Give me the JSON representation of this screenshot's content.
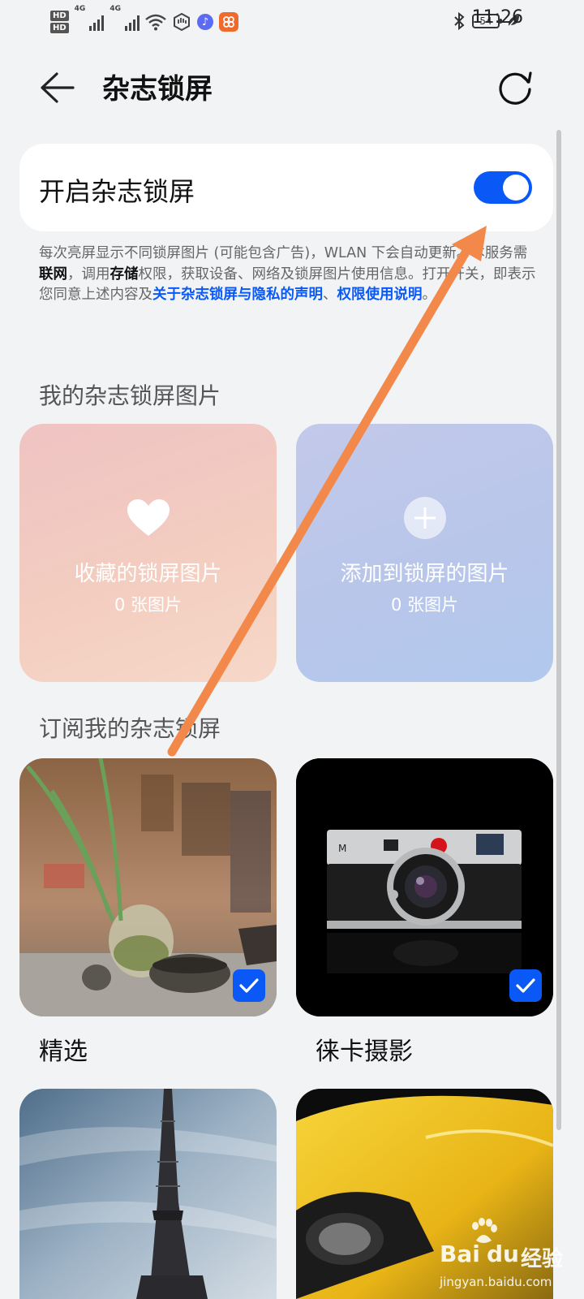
{
  "status_bar": {
    "hd1": "HD",
    "hd2": "HD",
    "net1": "4G",
    "net2": "4G",
    "battery": "54",
    "time": "11:26"
  },
  "header": {
    "title": "杂志锁屏"
  },
  "toggle": {
    "label": "开启杂志锁屏",
    "on": true,
    "accent": "#0a59f7"
  },
  "description": {
    "t1": "每次亮屏显示不同锁屏图片 (可能包含广告)，WLAN 下会自动更新。本服务需",
    "b1": "联网",
    "t2": "，调用",
    "b2": "存储",
    "t3": "权限，获取设备、网络及锁屏图片使用信息。打开开关，即表示您同意上述内容及",
    "link1": "关于杂志锁屏与隐私的声明",
    "t4": "、",
    "link2": "权限使用说明",
    "t5": "。"
  },
  "my_pictures": {
    "section_title": "我的杂志锁屏图片",
    "favorites": {
      "title": "收藏的锁屏图片",
      "count": "0 张图片",
      "icon": "heart-icon"
    },
    "added": {
      "title": "添加到锁屏的图片",
      "count": "0 张图片",
      "icon": "plus-icon"
    }
  },
  "subscriptions": {
    "section_title": "订阅我的杂志锁屏",
    "items": [
      {
        "label": "精选",
        "checked": true
      },
      {
        "label": "徕卡摄影",
        "checked": true
      }
    ]
  },
  "watermark": {
    "brand": "Bai",
    "brand2": "经验",
    "url": "jingyan.baidu.com"
  }
}
